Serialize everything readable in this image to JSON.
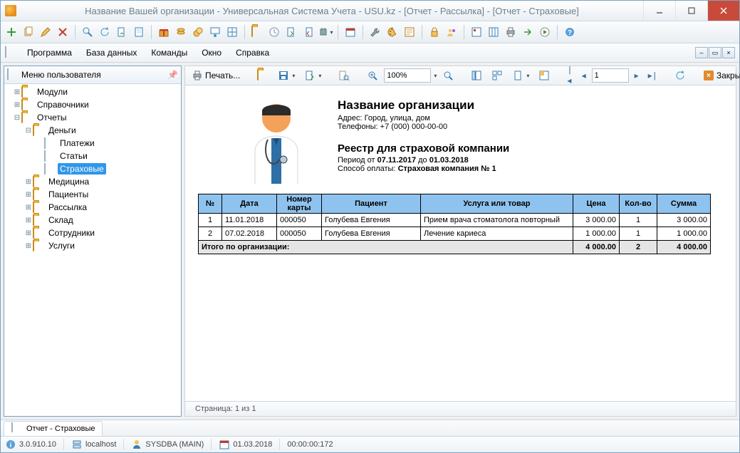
{
  "window": {
    "title": "Название Вашей организации - Универсальная Система Учета - USU.kz - [Отчет - Рассылка] - [Отчет - Страховые]"
  },
  "menu": {
    "program": "Программа",
    "database": "База данных",
    "commands": "Команды",
    "window": "Окно",
    "help": "Справка"
  },
  "side": {
    "title": "Меню пользователя",
    "modules": "Модули",
    "references": "Справочники",
    "reports": "Отчеты",
    "money": "Деньги",
    "payments": "Платежи",
    "articles": "Статьи",
    "insurance": "Страховые",
    "medicine": "Медицина",
    "patients": "Пациенты",
    "mailing": "Рассылка",
    "stock": "Склад",
    "staff": "Сотрудники",
    "services": "Услуги"
  },
  "rbar": {
    "print": "Печать...",
    "zoom": "100%",
    "page": "1",
    "close": "Закрыть"
  },
  "report": {
    "org_title": "Название организации",
    "addr_label": "Адрес:",
    "addr": "Город, улица, дом",
    "phones_label": "Телефоны:",
    "phones": "+7 (000) 000-00-00",
    "reg_title": "Реестр для страховой компании",
    "period_label": "Период от",
    "period_from": "07.11.2017",
    "period_to_label": "до",
    "period_to": "01.03.2018",
    "pay_label": "Способ оплаты:",
    "pay_val": "Страховая компания № 1",
    "th_n": "№",
    "th_date": "Дата",
    "th_card": "Номер карты",
    "th_patient": "Пациент",
    "th_service": "Услуга или товар",
    "th_price": "Цена",
    "th_qty": "Кол-во",
    "th_sum": "Сумма",
    "rows": [
      {
        "n": "1",
        "date": "11.01.2018",
        "card": "000050",
        "patient": "Голубева Евгения",
        "svc": "Прием врача стоматолога повторный",
        "price": "3 000.00",
        "qty": "1",
        "sum": "3 000.00"
      },
      {
        "n": "2",
        "date": "07.02.2018",
        "card": "000050",
        "patient": "Голубева Евгения",
        "svc": "Лечение кариеса",
        "price": "1 000.00",
        "qty": "1",
        "sum": "1 000.00"
      }
    ],
    "total_label": "Итого по организации:",
    "total_price": "4 000.00",
    "total_qty": "2",
    "total_sum": "4 000.00",
    "pagebar": "Страница: 1 из 1"
  },
  "tab": {
    "label": "Отчет - Страховые"
  },
  "status": {
    "ver": "3.0.910.10",
    "host": "localhost",
    "user": "SYSDBA (MAIN)",
    "date": "01.03.2018",
    "time": "00:00:00:172"
  }
}
